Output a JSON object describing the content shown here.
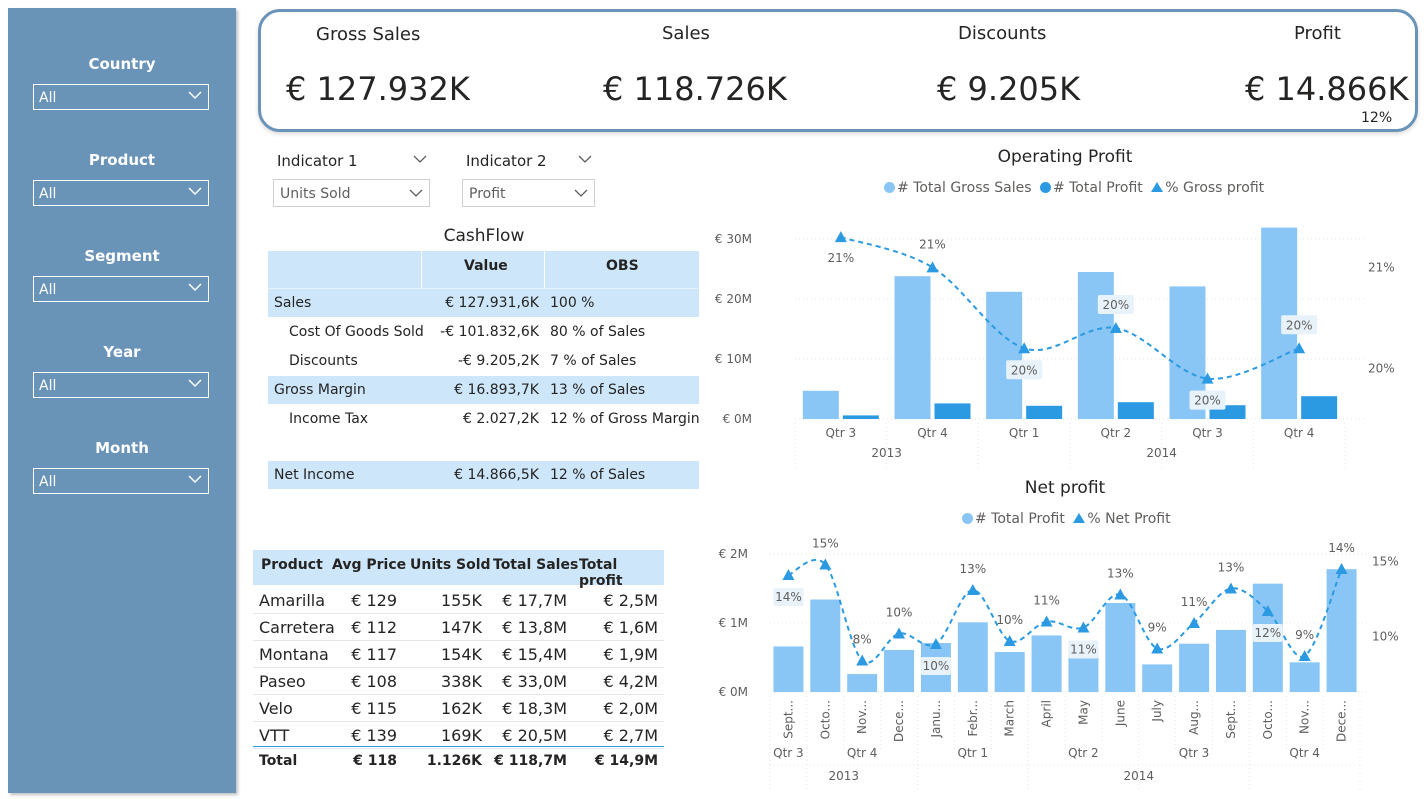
{
  "filters": [
    {
      "label": "Country",
      "value": "All"
    },
    {
      "label": "Product",
      "value": "All"
    },
    {
      "label": "Segment",
      "value": "All"
    },
    {
      "label": "Year",
      "value": "All"
    },
    {
      "label": "Month",
      "value": "All"
    }
  ],
  "kpis": {
    "gross_sales": {
      "label": "Gross Sales",
      "value": "€ 127.932K"
    },
    "sales": {
      "label": "Sales",
      "value": "€ 118.726K"
    },
    "discounts": {
      "label": "Discounts",
      "value": "€ 9.205K"
    },
    "profit": {
      "label": "Profit",
      "value": "€ 14.866K",
      "sub": "12%"
    }
  },
  "indicators": {
    "ind1": {
      "label": "Indicator 1",
      "value": "Units Sold"
    },
    "ind2": {
      "label": "Indicator 2",
      "value": "Profit"
    }
  },
  "cashflow": {
    "title": "CashFlow",
    "headers": {
      "value": "Value",
      "obs": "OBS"
    },
    "rows": [
      {
        "label": "Sales",
        "value": "€ 127.931,6K",
        "obs": "100 %",
        "highlight": true,
        "indent": false
      },
      {
        "label": "Cost Of Goods Sold",
        "value": "-€ 101.832,6K",
        "obs": "80 % of Sales",
        "highlight": false,
        "indent": true
      },
      {
        "label": "Discounts",
        "value": "-€ 9.205,2K",
        "obs": "7 % of Sales",
        "highlight": false,
        "indent": true
      },
      {
        "label": "Gross Margin",
        "value": "€ 16.893,7K",
        "obs": "13 % of Sales",
        "highlight": true,
        "indent": false
      },
      {
        "label": "Income Tax",
        "value": "€ 2.027,2K",
        "obs": "12 % of Gross Margin",
        "highlight": false,
        "indent": true
      },
      {
        "label": "Net Income",
        "value": "€ 14.866,5K",
        "obs": "12 % of Sales",
        "highlight": true,
        "indent": false
      }
    ]
  },
  "products": {
    "headers": [
      "Product",
      "Avg Price",
      "Units Sold",
      "Total Sales",
      "Total profit"
    ],
    "rows": [
      [
        "Amarilla",
        "€ 129",
        "155K",
        "€ 17,7M",
        "€ 2,5M"
      ],
      [
        "Carretera",
        "€ 112",
        "147K",
        "€ 13,8M",
        "€ 1,6M"
      ],
      [
        "Montana",
        "€ 117",
        "154K",
        "€ 15,4M",
        "€ 1,9M"
      ],
      [
        "Paseo",
        "€ 108",
        "338K",
        "€ 33,0M",
        "€ 4,2M"
      ],
      [
        "Velo",
        "€ 115",
        "162K",
        "€ 18,3M",
        "€ 2,0M"
      ],
      [
        "VTT",
        "€ 139",
        "169K",
        "€ 20,5M",
        "€ 2,7M"
      ]
    ],
    "total": [
      "Total",
      "€ 118",
      "1.126K",
      "€ 118,7M",
      "€ 14,9M"
    ]
  },
  "chart_data": [
    {
      "type": "bar",
      "title": "Operating Profit",
      "legend": [
        "# Total Gross Sales",
        "# Total Profit",
        "% Gross profit"
      ],
      "categories": [
        "Qtr 3",
        "Qtr 4",
        "Qtr 1",
        "Qtr 2",
        "Qtr 3",
        "Qtr 4"
      ],
      "groups": [
        {
          "label": "2013",
          "count": 2
        },
        {
          "label": "2014",
          "count": 4
        }
      ],
      "yticks": [
        "€ 0M",
        "€ 10M",
        "€ 20M",
        "€ 30M"
      ],
      "ylim": [
        0,
        32
      ],
      "y2ticks": [
        "20%",
        "21%"
      ],
      "y2lim": [
        19.5,
        21.4
      ],
      "series": [
        {
          "name": "# Total Gross Sales",
          "values": [
            4.7,
            23.8,
            21.2,
            24.5,
            22.1,
            31.9
          ],
          "color": "#8ac6f5"
        },
        {
          "name": "# Total Profit",
          "values": [
            0.6,
            2.6,
            2.2,
            2.8,
            2.3,
            3.8
          ],
          "color": "#2b9ae2"
        },
        {
          "name": "% Gross profit",
          "values": [
            21.3,
            21.0,
            20.2,
            20.4,
            19.9,
            20.2
          ],
          "labels": [
            "21%",
            "21%",
            "20%",
            "20%",
            "20%",
            "20%"
          ],
          "color": "#2b9ae2"
        }
      ]
    },
    {
      "type": "bar",
      "title": "Net profit",
      "legend": [
        "# Total Profit",
        "% Net Profit"
      ],
      "categories": [
        "Sept...",
        "Octo...",
        "Nov...",
        "Dece...",
        "Janu...",
        "Febr...",
        "March",
        "April",
        "May",
        "June",
        "July",
        "Aug...",
        "Sept...",
        "Octo...",
        "Nov...",
        "Dece..."
      ],
      "quarters": [
        {
          "label": "Qtr 3",
          "count": 1
        },
        {
          "label": "Qtr 4",
          "count": 3
        },
        {
          "label": "Qtr 1",
          "count": 3
        },
        {
          "label": "Qtr 2",
          "count": 3
        },
        {
          "label": "Qtr 3",
          "count": 3
        },
        {
          "label": "Qtr 4",
          "count": 3
        }
      ],
      "groups": [
        {
          "label": "2013",
          "count": 4
        },
        {
          "label": "2014",
          "count": 12
        }
      ],
      "yticks": [
        "€ 0M",
        "€ 1M",
        "€ 2M"
      ],
      "ylim": [
        0,
        2
      ],
      "y2ticks": [
        "10%",
        "15%"
      ],
      "y2lim": [
        6.3,
        15.5
      ],
      "series": [
        {
          "name": "# Total Profit",
          "values": [
            0.66,
            1.34,
            0.26,
            0.61,
            0.71,
            1.01,
            0.58,
            0.82,
            0.64,
            1.29,
            0.4,
            0.7,
            0.9,
            1.57,
            0.43,
            1.78
          ],
          "color": "#8ac6f5"
        },
        {
          "name": "% Net Profit",
          "values": [
            14.1,
            14.8,
            8.4,
            10.2,
            9.5,
            13.1,
            9.7,
            11.0,
            10.6,
            12.8,
            9.2,
            10.9,
            13.2,
            11.7,
            8.7,
            14.5
          ],
          "labels": [
            "14%",
            "15%",
            "8%",
            "10%",
            "10%",
            "13%",
            "10%",
            "11%",
            "11%",
            "13%",
            "9%",
            "11%",
            "13%",
            "12%",
            "9%",
            "14%"
          ],
          "color": "#2b9ae2"
        }
      ]
    }
  ]
}
